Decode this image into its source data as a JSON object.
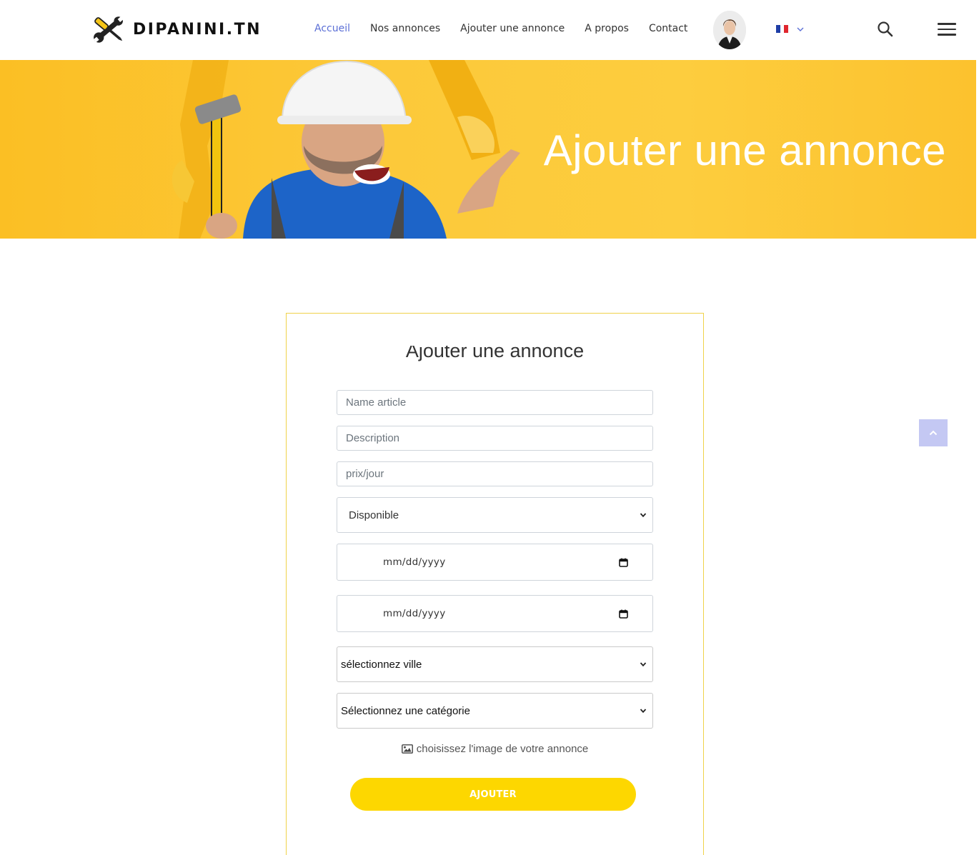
{
  "header": {
    "logo_text": "DIPANINI.TN",
    "nav": [
      {
        "label": "Accueil",
        "active": true
      },
      {
        "label": "Nos annonces",
        "active": false
      },
      {
        "label": "Ajouter une annonce",
        "active": false
      },
      {
        "label": "A propos",
        "active": false
      },
      {
        "label": "Contact",
        "active": false
      }
    ],
    "language": "fr",
    "icons": [
      "tools-logo-icon",
      "user-avatar",
      "flag-france-icon",
      "chevron-down-icon",
      "search-icon",
      "hamburger-menu-icon"
    ]
  },
  "banner": {
    "title": "Ajouter une annonce"
  },
  "form": {
    "heading": "Ajouter une annonce",
    "name_placeholder": "Name article",
    "description_placeholder": "Description",
    "price_placeholder": "prix/jour",
    "availability_selected": "Disponible",
    "date_start_placeholder": "mm/dd/yyyy",
    "date_end_placeholder": "mm/dd/yyyy",
    "city_selected": "sélectionnez ville",
    "category_selected": "Sélectionnez une catégorie",
    "image_label": "choisissez l'image de votre annonce",
    "submit_label": "AJOUTER"
  },
  "colors": {
    "accent_blue": "#5b6fd6",
    "banner_yellow": "#fcc93a",
    "button_yellow": "#fdd700",
    "card_border": "#f0d24a",
    "scroll_top_bg": "#c4c8f3"
  }
}
